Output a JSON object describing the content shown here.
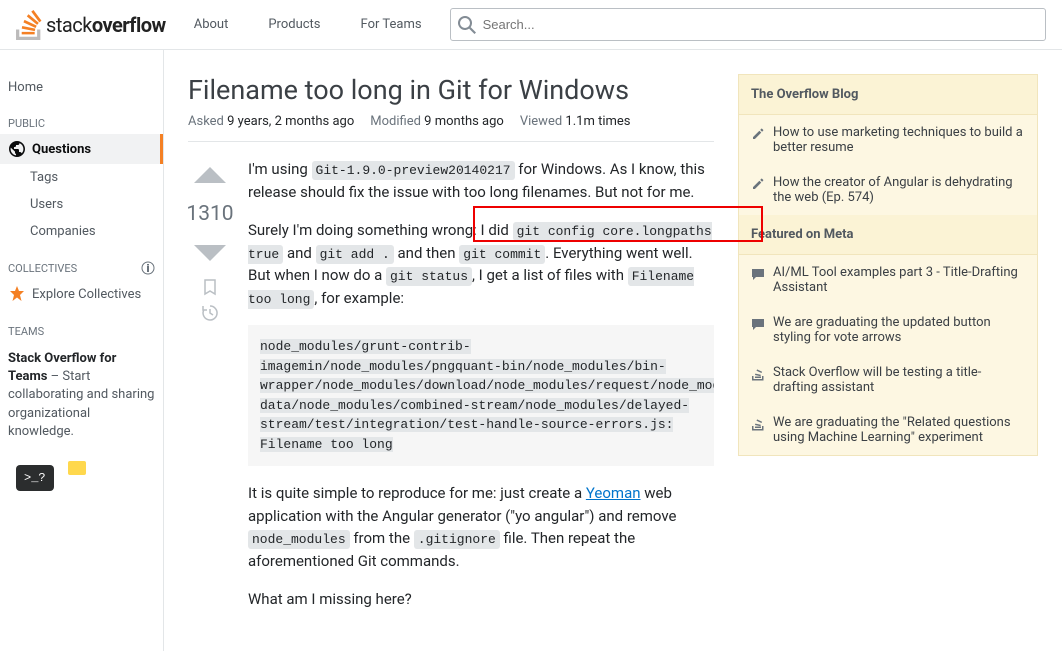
{
  "topbar": {
    "logo_text_1": "stack",
    "logo_text_2": "overflow",
    "about": "About",
    "products": "Products",
    "for_teams": "For Teams",
    "search_placeholder": "Search..."
  },
  "sidebar": {
    "home": "Home",
    "public": "PUBLIC",
    "questions": "Questions",
    "tags": "Tags",
    "users": "Users",
    "companies": "Companies",
    "collectives": "COLLECTIVES",
    "explore": "Explore Collectives",
    "teams": "TEAMS",
    "teams_promo_bold": "Stack Overflow for Teams",
    "teams_promo_rest": " – Start collaborating and sharing organizational knowledge.",
    "teams_code": ">_?"
  },
  "question": {
    "title": "Filename too long in Git for Windows",
    "asked_label": "Asked",
    "asked_value": "9 years, 2 months ago",
    "modified_label": "Modified",
    "modified_value": "9 months ago",
    "viewed_label": "Viewed",
    "viewed_value": "1.1m times",
    "votes": "1310",
    "p1_a": "I'm using ",
    "p1_code1": "Git-1.9.0-preview20140217",
    "p1_b": " for Windows. As I know, this release should fix the issue with too long filenames. But not for me.",
    "p2_a": "Surely I'm doing something wrong: I did ",
    "p2_code1": "git config core.longpaths true",
    "p2_b": " and ",
    "p2_code2": "git add .",
    "p2_c": " and then ",
    "p2_code3": "git commit",
    "p2_d": ". Everything went well. But when I now do a ",
    "p2_code4": "git status",
    "p2_e": ", I get a list of files with ",
    "p2_code5": "Filename too long",
    "p2_f": ", for example:",
    "codeblock": "node_modules/grunt-contrib-imagemin/node_modules/pngquant-bin/node_modules/bin-wrapper/node_modules/download/node_modules/request/node_modules/form-data/node_modules/combined-stream/node_modules/delayed-stream/test/integration/test-handle-source-errors.js: Filename too long",
    "p3_a": "It is quite simple to reproduce for me: just create a ",
    "p3_link": "Yeoman",
    "p3_b": " web application with the Angular generator (\"yo angular\") and remove ",
    "p3_code1": "node_modules",
    "p3_c": " from the ",
    "p3_code2": ".gitignore",
    "p3_d": " file. Then repeat the aforementioned Git commands.",
    "p4": "What am I missing here?"
  },
  "rightbar": {
    "blog_head": "The Overflow Blog",
    "blog1": "How to use marketing techniques to build a better resume",
    "blog2": "How the creator of Angular is dehydrating the web (Ep. 574)",
    "meta_head": "Featured on Meta",
    "meta1": "AI/ML Tool examples part 3 - Title-Drafting Assistant",
    "meta2": "We are graduating the updated button styling for vote arrows",
    "meta3": "Stack Overflow will be testing a title-drafting assistant",
    "meta4": "We are graduating the \"Related questions using Machine Learning\" experiment"
  }
}
